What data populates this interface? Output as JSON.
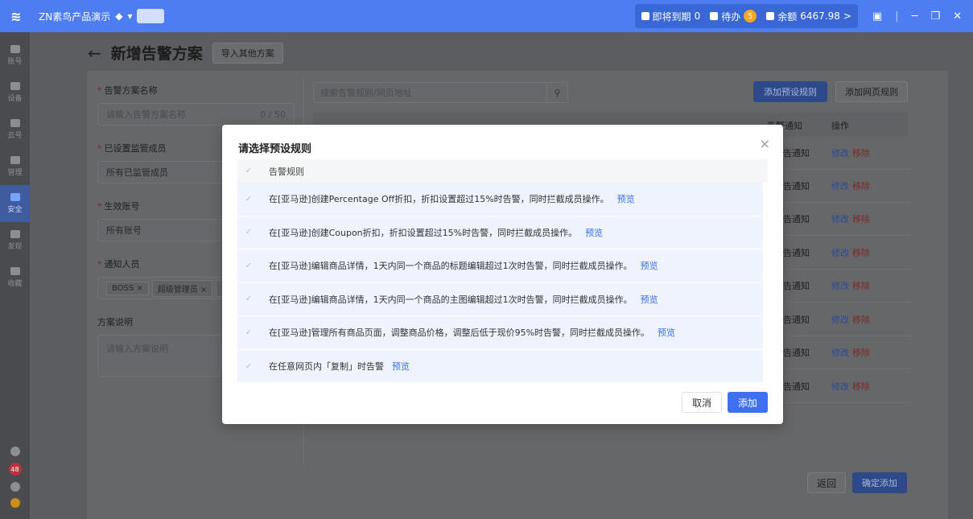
{
  "topbar": {
    "brand": "ZN素鸟产品演示",
    "expiring_label": "即将到期",
    "expiring_count": "0",
    "todo_label": "待办",
    "todo_count": "5",
    "balance_label": "余额",
    "balance_value": "6467.98",
    "chevron": ">",
    "divider": "|",
    "minimize": "─",
    "restore": "❐",
    "close": "✕"
  },
  "sidebar": {
    "items": [
      {
        "label": "账号",
        "icon": "account-icon"
      },
      {
        "label": "设备",
        "icon": "device-icon"
      },
      {
        "label": "云号",
        "icon": "cloud-icon"
      },
      {
        "label": "管理",
        "icon": "manage-icon"
      },
      {
        "label": "安全",
        "icon": "security-icon",
        "active": true
      },
      {
        "label": "发现",
        "icon": "discover-icon"
      },
      {
        "label": "收藏",
        "icon": "star-icon"
      }
    ],
    "notify_count": "48"
  },
  "page": {
    "title": "新增告警方案",
    "back": "←",
    "import_btn": "导入其他方案",
    "form": {
      "name_label": "告警方案名称",
      "name_placeholder": "请输入告警方案名称",
      "name_count": "0 / 50",
      "members_label": "已设置监管成员",
      "members_value": "所有已监管成员",
      "account_label": "生效账号",
      "account_value": "所有账号",
      "notify_label": "通知人员",
      "notify_tags": [
        "BOSS ×",
        "超级管理员 ×",
        "管"
      ],
      "desc_label": "方案说明",
      "desc_placeholder": "请输入方案说明"
    },
    "search_placeholder": "搜索告警规则/网页地址",
    "add_preset_btn": "添加预设规则",
    "add_web_btn": "添加网页规则",
    "col_notify": "告警通知",
    "col_op": "操作",
    "row_notify": "告通知",
    "row_edit": "修改",
    "row_remove": "移除",
    "return_btn": "返回",
    "confirm_btn": "确定添加"
  },
  "modal": {
    "title": "请选择预设规则",
    "close": "×",
    "header_label": "告警规则",
    "preview_label": "预览",
    "rules": [
      "在[亚马逊]创建Percentage Off折扣，折扣设置超过15%时告警，同时拦截成员操作。",
      "在[亚马逊]创建Coupon折扣，折扣设置超过15%时告警，同时拦截成员操作。",
      "在[亚马逊]编辑商品详情，1天内同一个商品的标题编辑超过1次时告警，同时拦截成员操作。",
      "在[亚马逊]编辑商品详情，1天内同一个商品的主图编辑超过1次时告警，同时拦截成员操作。",
      "在[亚马逊]管理所有商品页面，调整商品价格，调整后低于现价95%时告警，同时拦截成员操作。",
      "在任意网页内「复制」时告警"
    ],
    "cancel_btn": "取消",
    "add_btn": "添加"
  }
}
